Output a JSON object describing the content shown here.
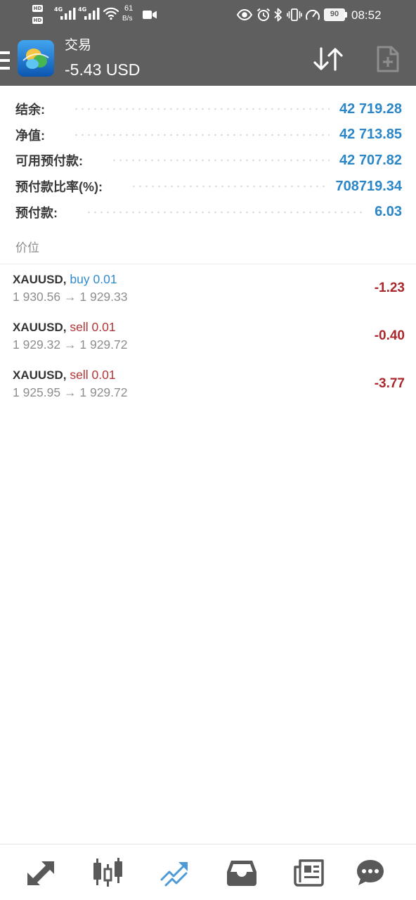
{
  "status_bar": {
    "sim_badges": [
      "HD",
      "HD"
    ],
    "network_types": [
      "4G",
      "4G"
    ],
    "net_speed": "61",
    "net_speed_unit": "B/s",
    "battery_level": "90",
    "time": "08:52",
    "icons": {
      "signal": "signal-icon",
      "wifi": "wifi-icon",
      "video": "video-camera-icon",
      "eye": "eye-icon",
      "alarm": "alarm-icon",
      "bluetooth": "bluetooth-icon",
      "vibrate": "vibrate-icon",
      "speed": "gauge-icon",
      "battery": "battery-icon"
    }
  },
  "header": {
    "title": "交易",
    "floating_profit": "-5.43 USD",
    "icons": {
      "menu": "menu-icon",
      "logo": "app-logo",
      "sort": "sort-icon",
      "new_order": "new-document-icon"
    }
  },
  "account_summary": [
    {
      "label": "结余:",
      "value": "42 719.28"
    },
    {
      "label": "净值:",
      "value": "42 713.85"
    },
    {
      "label": "可用预付款:",
      "value": "42 707.82"
    },
    {
      "label": "预付款比率(%):",
      "value": "708719.34"
    },
    {
      "label": "预付款:",
      "value": "6.03"
    }
  ],
  "positions_section": {
    "title": "价位",
    "symbol_separator": ",",
    "price_arrow": "→"
  },
  "positions": [
    {
      "symbol": "XAUUSD",
      "type": "buy",
      "volume": "0.01",
      "open_price": "1 930.56",
      "current_price": "1 929.33",
      "profit": "-1.23"
    },
    {
      "symbol": "XAUUSD",
      "type": "sell",
      "volume": "0.01",
      "open_price": "1 929.32",
      "current_price": "1 929.72",
      "profit": "-0.40"
    },
    {
      "symbol": "XAUUSD",
      "type": "sell",
      "volume": "0.01",
      "open_price": "1 925.95",
      "current_price": "1 929.72",
      "profit": "-3.77"
    }
  ],
  "bottom_nav": [
    {
      "icon": "quotes-icon",
      "active": false
    },
    {
      "icon": "chart-icon",
      "active": false
    },
    {
      "icon": "trade-icon",
      "active": true
    },
    {
      "icon": "history-icon",
      "active": false
    },
    {
      "icon": "news-icon",
      "active": false
    },
    {
      "icon": "chat-icon",
      "active": false
    }
  ],
  "colors": {
    "bar_background": "#5f5f5f",
    "value_blue": "#2a86c6",
    "buy_blue": "#2f8bcb",
    "sell_red": "#b33434",
    "loss_red": "#a8282b",
    "active_tab": "#4d9ad6",
    "inactive_icon": "#595959"
  }
}
